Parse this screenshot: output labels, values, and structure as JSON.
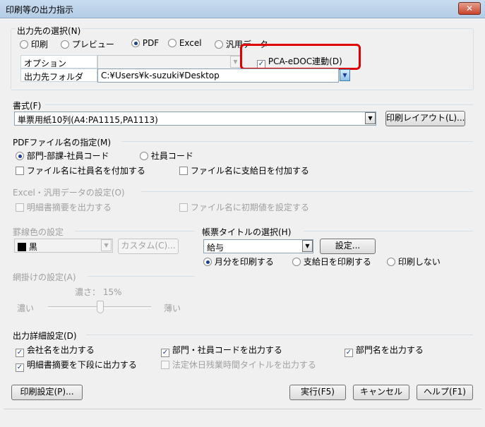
{
  "window": {
    "title": "印刷等の出力指示",
    "close_label": "✕"
  },
  "dest": {
    "heading": "出力先の選択(N)",
    "options": [
      "印刷",
      "プレビュー",
      "PDF",
      "Excel",
      "汎用データ"
    ],
    "selected": "PDF",
    "option_label": "オプション",
    "folder_label": "出力先フォルダ",
    "folder_value": "C:¥Users¥k-suzuki¥Desktop",
    "pca_label": "PCA-eDOC連動(D)",
    "pca_checked": true
  },
  "format": {
    "heading": "書式(F)",
    "value": "単票用紙10列(A4:PA1115,PA1113)",
    "layout_button": "印刷レイアウト(L)..."
  },
  "pdfname": {
    "heading": "PDFファイル名の指定(M)",
    "radio1": "部門-部課-社員コード",
    "radio2": "社員コード",
    "check1": "ファイル名に社員名を付加する",
    "check2": "ファイル名に支給日を付加する"
  },
  "excel": {
    "heading": "Excel・汎用データの設定(O)",
    "check1": "明細書摘要を出力する",
    "check2": "ファイル名に初期値を設定する"
  },
  "ruled": {
    "heading": "罫線色の設定",
    "color_value": "黒",
    "custom_button": "カスタム(C)..."
  },
  "formtitle": {
    "heading": "帳票タイトルの選択(H)",
    "value": "給与",
    "settings_button": "設定...",
    "radio1": "月分を印刷する",
    "radio2": "支給日を印刷する",
    "radio3": "印刷しない"
  },
  "shade": {
    "heading": "網掛けの設定(A)",
    "density_label": "濃さ： 15%",
    "dark_label": "濃い",
    "light_label": "薄い",
    "density_percent": 15
  },
  "detail": {
    "heading": "出力詳細設定(D)",
    "check1": "会社名を出力する",
    "check2": "部門・社員コードを出力する",
    "check3": "部門名を出力する",
    "check4": "明細書摘要を下段に出力する",
    "check5": "法定休日残業時間タイトルを出力する"
  },
  "footer": {
    "print_settings": "印刷設定(P)...",
    "execute": "実行(F5)",
    "cancel": "キャンセル",
    "help": "ヘルプ(F1)"
  }
}
